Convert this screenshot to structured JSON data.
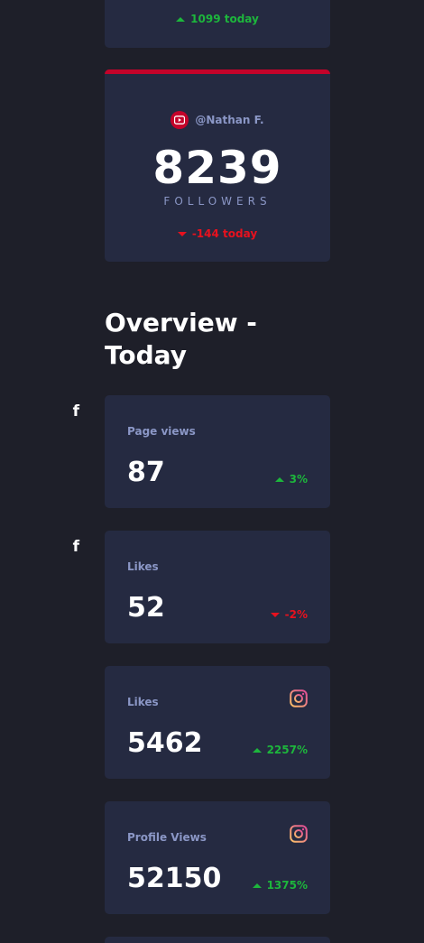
{
  "top_card": {
    "delta_text": "1099 today",
    "trend": "up"
  },
  "youtube_card": {
    "accent_color": "#c4032a",
    "icon": "youtube-icon",
    "handle": "@Nathan F.",
    "count": "8239",
    "label": "FOLLOWERS",
    "delta_text": "-144 today",
    "trend": "down"
  },
  "overview": {
    "title": "Overview - Today",
    "cards": [
      {
        "label": "Page views",
        "icon": "facebook-icon",
        "value": "87",
        "delta": "3%",
        "trend": "up"
      },
      {
        "label": "Likes",
        "icon": "facebook-icon",
        "value": "52",
        "delta": "-2%",
        "trend": "down"
      },
      {
        "label": "Likes",
        "icon": "instagram-icon",
        "value": "5462",
        "delta": "2257%",
        "trend": "up"
      },
      {
        "label": "Profile Views",
        "icon": "instagram-icon",
        "value": "52150",
        "delta": "1375%",
        "trend": "up"
      }
    ]
  },
  "colors": {
    "background": "#1e1f29",
    "card": "#252a41",
    "positive": "#1db63c",
    "negative": "#e8111e",
    "muted_text": "#8b97c6"
  }
}
